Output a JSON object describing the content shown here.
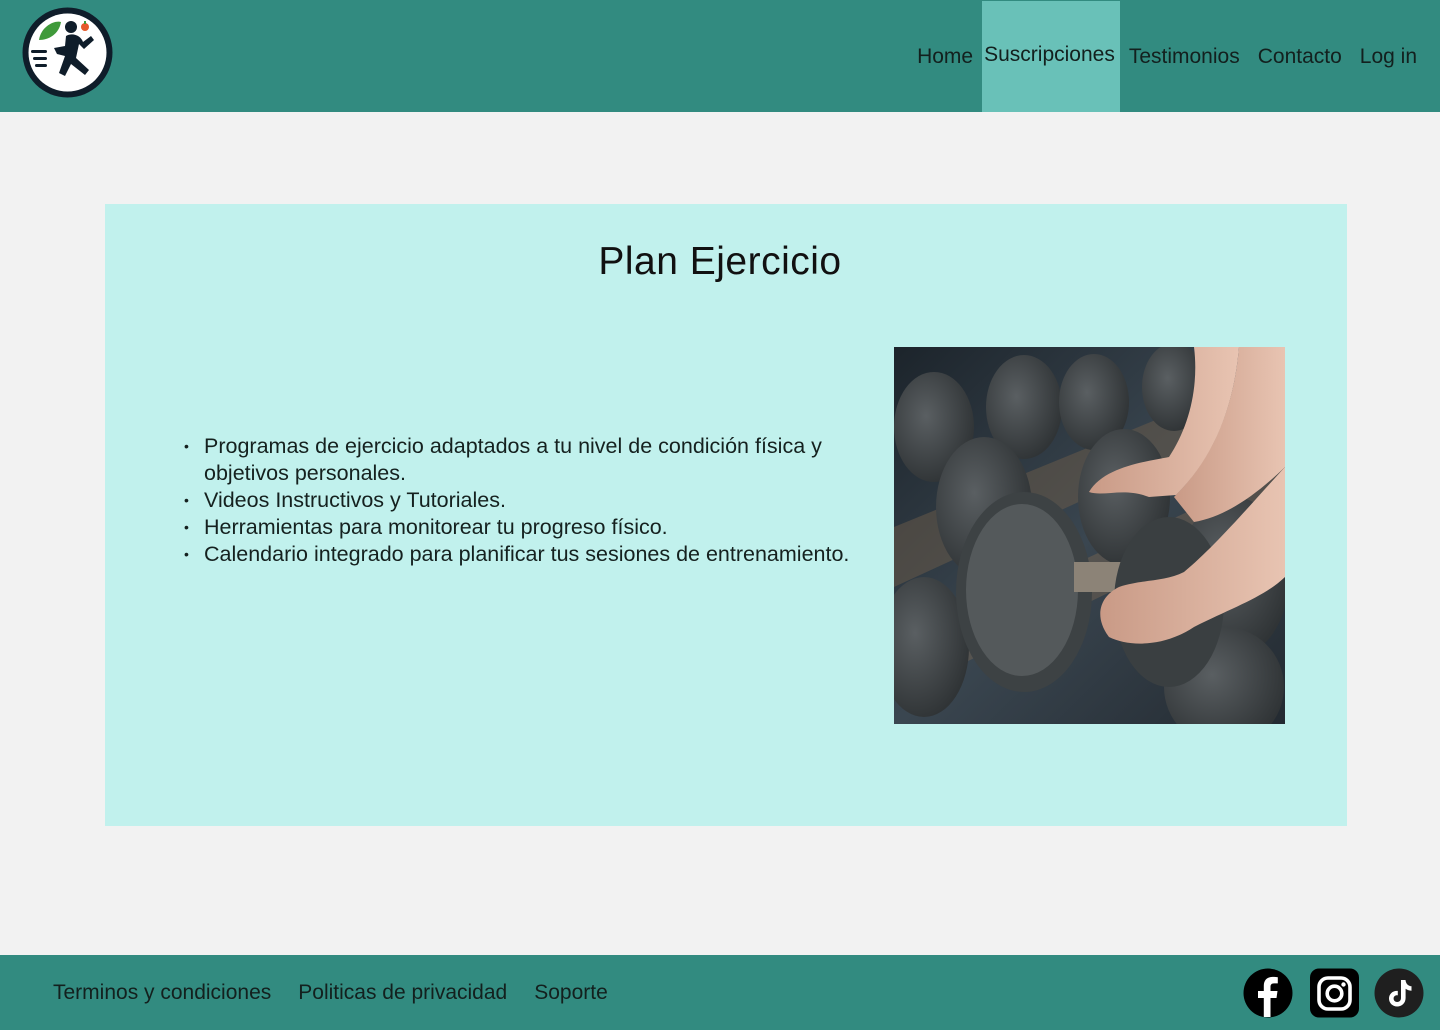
{
  "header": {
    "logo_alt": "logo",
    "nav": [
      {
        "label": "Home",
        "active": false
      },
      {
        "label": "Suscripciones",
        "active": true
      },
      {
        "label": "Testimonios",
        "active": false
      },
      {
        "label": "Contacto",
        "active": false
      },
      {
        "label": "Log in",
        "active": false
      }
    ]
  },
  "main": {
    "title": "Plan Ejercicio",
    "features": [
      "Programas de ejercicio adaptados a tu nivel de condición física y objetivos personales.",
      "Videos Instructivos y Tutoriales.",
      "Herramientas para monitorear tu progreso físico.",
      "Calendario integrado para planificar tus sesiones de entrenamiento."
    ],
    "image": "dumbbells-photo"
  },
  "footer": {
    "links": [
      "Terminos y condiciones",
      "Politicas de privacidad",
      "Soporte"
    ],
    "social": [
      "facebook-icon",
      "instagram-icon",
      "tiktok-icon"
    ]
  },
  "colors": {
    "header_bg": "#328b80",
    "active_nav_bg": "#69c1b8",
    "card_bg": "#c1f1ed",
    "page_bg": "#f2f2f2"
  }
}
